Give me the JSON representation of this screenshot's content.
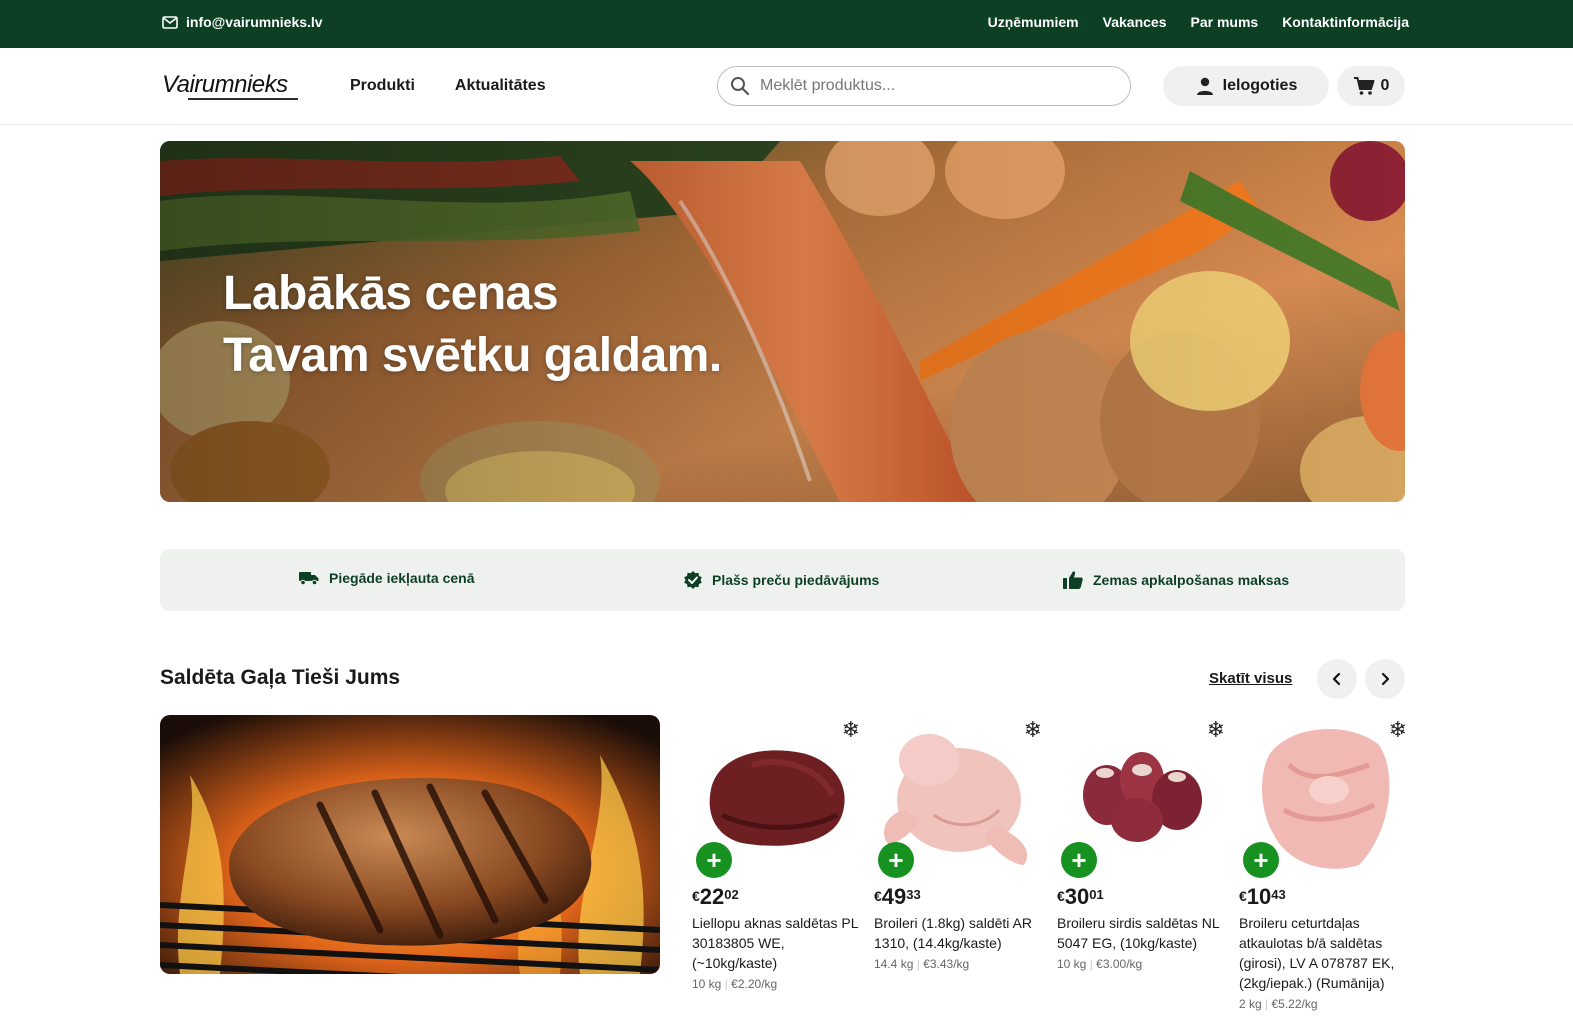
{
  "topbar": {
    "email": "info@vairumnieks.lv",
    "links": [
      "Uzņēmumiem",
      "Vakances",
      "Par mums",
      "Kontaktinformācija"
    ]
  },
  "header": {
    "logo_text": "Vairumnieks",
    "nav": [
      "Produkti",
      "Aktualitātes"
    ],
    "search_placeholder": "Meklēt produktus...",
    "login_label": "Ielogoties",
    "cart_count": "0"
  },
  "hero": {
    "line1": "Labākās cenas",
    "line2": "Tavam svētku galdam."
  },
  "features": [
    {
      "icon": "truck-icon",
      "label": "Piegāde iekļauta cenā"
    },
    {
      "icon": "verified-badge-icon",
      "label": "Plašs preču piedāvājums"
    },
    {
      "icon": "thumbs-up-icon",
      "label": "Zemas apkalpošanas maksas"
    }
  ],
  "section": {
    "title": "Saldēta Gaļa Tieši Jums",
    "see_all": "Skatīt visus"
  },
  "products": [
    {
      "currency": "€",
      "price_int": "22",
      "price_dec": "02",
      "name": "Liellopu aknas saldētas PL 30183805 WE, (~10kg/kaste)",
      "weight": "10 kg",
      "unit_price": "€2.20/kg"
    },
    {
      "currency": "€",
      "price_int": "49",
      "price_dec": "33",
      "name": "Broileri (1.8kg) saldēti AR 1310, (14.4kg/kaste)",
      "weight": "14.4 kg",
      "unit_price": "€3.43/kg"
    },
    {
      "currency": "€",
      "price_int": "30",
      "price_dec": "01",
      "name": "Broileru sirdis saldētas NL 5047 EG, (10kg/kaste)",
      "weight": "10 kg",
      "unit_price": "€3.00/kg"
    },
    {
      "currency": "€",
      "price_int": "10",
      "price_dec": "43",
      "name": "Broileru ceturtdaļas atkaulotas b/ā saldētas (girosi), LV A 078787 EK, (2kg/iepak.) (Rumānija)",
      "weight": "2 kg",
      "unit_price": "€5.22/kg"
    }
  ],
  "colors": {
    "brand_dark_green": "#0d3f25",
    "add_button_green": "#17911f",
    "features_bg": "#eff1ef"
  }
}
